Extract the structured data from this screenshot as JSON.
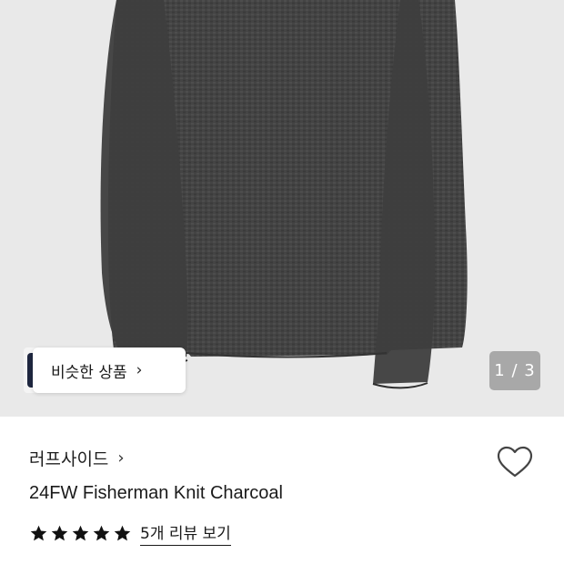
{
  "gallery": {
    "counter": "1 / 3",
    "similar_button_label": "비슷한 상품",
    "chevron_icon": "chevron-right-icon"
  },
  "product": {
    "brand": "러프사이드",
    "title": "24FW Fisherman Knit Charcoal",
    "rating_stars": 5,
    "reviews_link": "5개 리뷰 보기",
    "like_icon": "heart-outline-icon"
  },
  "colors": {
    "image_background": "#e9e9e9",
    "sweater": "#434343",
    "counter_background": "#a8a8a8",
    "text": "#111111"
  }
}
